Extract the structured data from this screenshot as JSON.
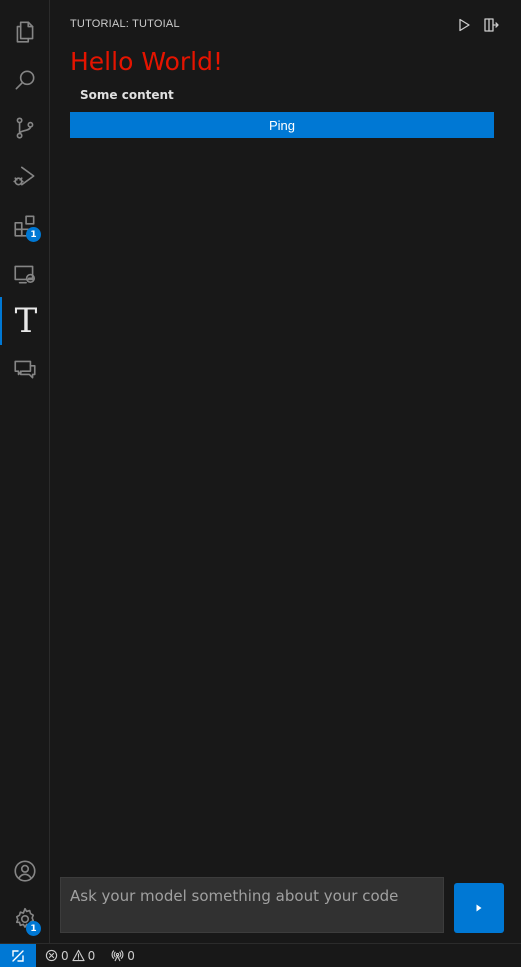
{
  "activity_bar": {
    "extensions_badge": "1",
    "settings_badge": "1",
    "tutorial_glyph": "T",
    "icons": [
      "explorer-icon",
      "search-icon",
      "source-control-icon",
      "run-debug-icon",
      "extensions-icon",
      "remote-explorer-icon",
      "tutorial-icon",
      "chat-icon",
      "account-icon",
      "settings-gear-icon"
    ]
  },
  "panel": {
    "title": "TUTORIAL: TUTOIAL",
    "heading": "Hello World!",
    "content": "Some content",
    "ping_label": "Ping",
    "ask_placeholder": "Ask your model something about your code"
  },
  "status_bar": {
    "errors": "0",
    "warnings": "0",
    "ports": "0"
  },
  "colors": {
    "accent": "#0078d4",
    "heading": "#e51400",
    "background": "#181818"
  }
}
